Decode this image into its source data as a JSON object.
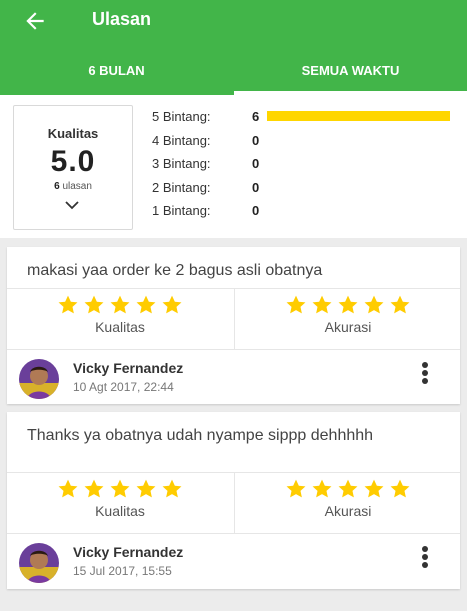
{
  "header": {
    "title": "Ulasan",
    "tabs": [
      "6 BULAN",
      "SEMUA WAKTU"
    ],
    "active_tab": 1,
    "color": "#42b549"
  },
  "summary": {
    "label": "Kualitas",
    "score": "5.0",
    "count": "6",
    "count_suffix": "ulasan",
    "distribution": [
      {
        "label": "5 Bintang:",
        "count": "6",
        "fraction": 1.0
      },
      {
        "label": "4 Bintang:",
        "count": "0",
        "fraction": 0
      },
      {
        "label": "3 Bintang:",
        "count": "0",
        "fraction": 0
      },
      {
        "label": "2 Bintang:",
        "count": "0",
        "fraction": 0
      },
      {
        "label": "1 Bintang:",
        "count": "0",
        "fraction": 0
      }
    ],
    "bar_color": "#ffd600"
  },
  "reviews": [
    {
      "text": "makasi yaa order ke 2 bagus asli obatnya",
      "rating_labels": [
        "Kualitas",
        "Akurasi"
      ],
      "quality_stars": 5,
      "accuracy_stars": 5,
      "user": "Vicky Fernandez",
      "date": "10 Agt 2017, 22:44"
    },
    {
      "text": "Thanks ya obatnya udah nyampe sippp dehhhhh",
      "rating_labels": [
        "Kualitas",
        "Akurasi"
      ],
      "quality_stars": 5,
      "accuracy_stars": 5,
      "user": "Vicky Fernandez",
      "date": "15 Jul 2017, 15:55"
    }
  ],
  "icons": {
    "back": "arrow-left-icon",
    "chevron": "chevron-down-icon",
    "star": "star-icon",
    "more": "more-vert-icon"
  },
  "star_color": "#ffcc00"
}
